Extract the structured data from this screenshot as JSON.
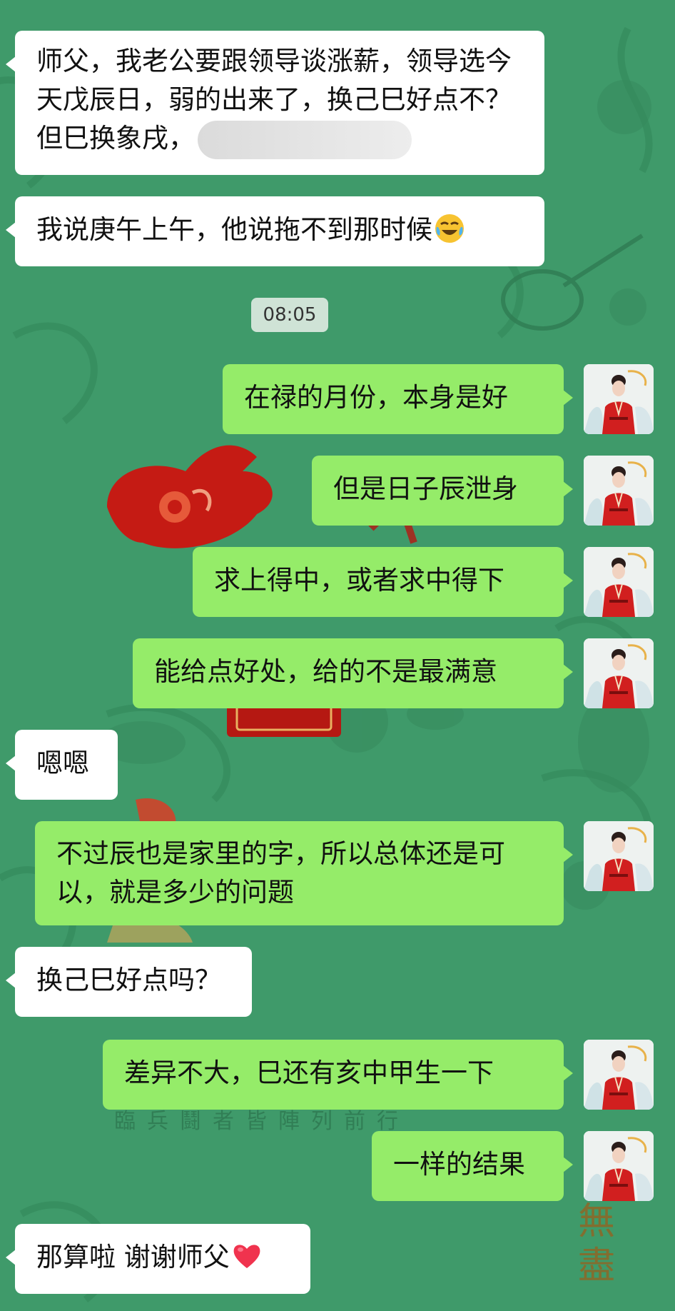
{
  "chat": {
    "timestamp": "08:05",
    "messages": [
      {
        "side": "in",
        "text": "师父，我老公要跟领导谈涨薪，领导选今天戊辰日，弱的出来了，换己巳好点不？但巳换象戌，"
      },
      {
        "side": "in",
        "text": "我说庚午上午，他说拖不到那时候"
      },
      {
        "side": "out",
        "text": "在禄的月份，本身是好"
      },
      {
        "side": "out",
        "text": "但是日子辰泄身"
      },
      {
        "side": "out",
        "text": "求上得中，或者求中得下"
      },
      {
        "side": "out",
        "text": "能给点好处，给的不是最满意"
      },
      {
        "side": "in",
        "text": "嗯嗯"
      },
      {
        "side": "out",
        "text": "不过辰也是家里的字，所以总体还是可以，就是多少的问题"
      },
      {
        "side": "in",
        "text": "换己巳好点吗？"
      },
      {
        "side": "out",
        "text": "差异不大，巳还有亥中甲生一下"
      },
      {
        "side": "out",
        "text": "一样的结果"
      },
      {
        "side": "in",
        "text": "那算啦 谢谢师父"
      }
    ]
  },
  "background": {
    "caption": "臨兵鬪者皆陣列前行",
    "vertical_text": "無盡"
  },
  "icons": {
    "blurred_text": "redacted-blur",
    "emoji_laugh_cry": "face-with-tears-of-joy-emoji",
    "emoji_heart": "red-heart-emoji",
    "avatar": "avatar-woman-red-hanfu"
  },
  "colors": {
    "chat_background": "#3f9a6a",
    "incoming_bubble": "#ffffff",
    "outgoing_bubble": "#95ec69",
    "timestamp_pill": "#cfe3d6"
  }
}
